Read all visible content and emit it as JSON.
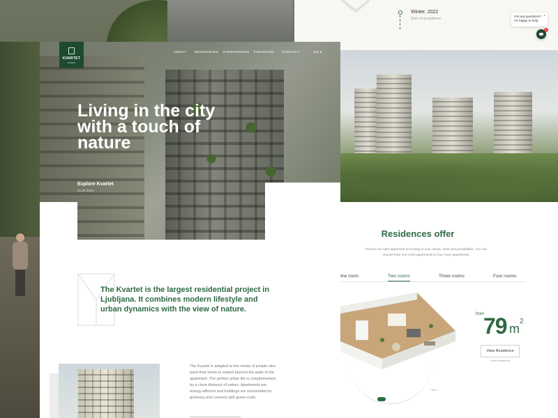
{
  "timeline": {
    "title": "Winter, 2022",
    "subtitle": "Start of acceptance"
  },
  "chat": {
    "message": "Got any questions? I'm happy to help.",
    "close": "×",
    "badge": "1"
  },
  "brand": {
    "name": "KVARTET",
    "tagline": "KOSEZI"
  },
  "nav": {
    "items": [
      "ABOUT",
      "RESIDENCES",
      "EXPERIENCES",
      "FINANCING",
      "CONTACT"
    ],
    "language": "EN ▾"
  },
  "hero": {
    "headline": "Living in the city with a touch of nature",
    "cta": "Explore Kvartet",
    "scroll": "Scroll down"
  },
  "intro": {
    "text": "The Kvartet is the largest residential project in Ljubljana. It combines modern lifestyle and urban dynamics with the view of nature."
  },
  "body": {
    "text": "The Kvartet is adapted to the needs of people who want their home to extend beyond the walls of the apartment. The perfect urban life is complemented by a close distance of nature. Apartments are energy efficient and buildings are surrounded by greenery and covered with green roofs."
  },
  "residences": {
    "title": "Residences offer",
    "description": "Choose the right apartment according to your needs, taste and possibilities. You can choose from one-room apartments to four-room apartments.",
    "tabs": [
      "One room",
      "Two rooms",
      "Three rooms",
      "Four rooms"
    ],
    "active_tab": "Two rooms",
    "from_label": "from",
    "area_value": "79",
    "area_unit": "m",
    "area_sup": "2",
    "view_button": "View Residence",
    "view_sub": "79 free residences",
    "plan_dims": "7.30 m"
  },
  "colors": {
    "brand_green": "#2f6a43",
    "dark_green": "#1e4a2f",
    "badge_red": "#e63b3b"
  }
}
